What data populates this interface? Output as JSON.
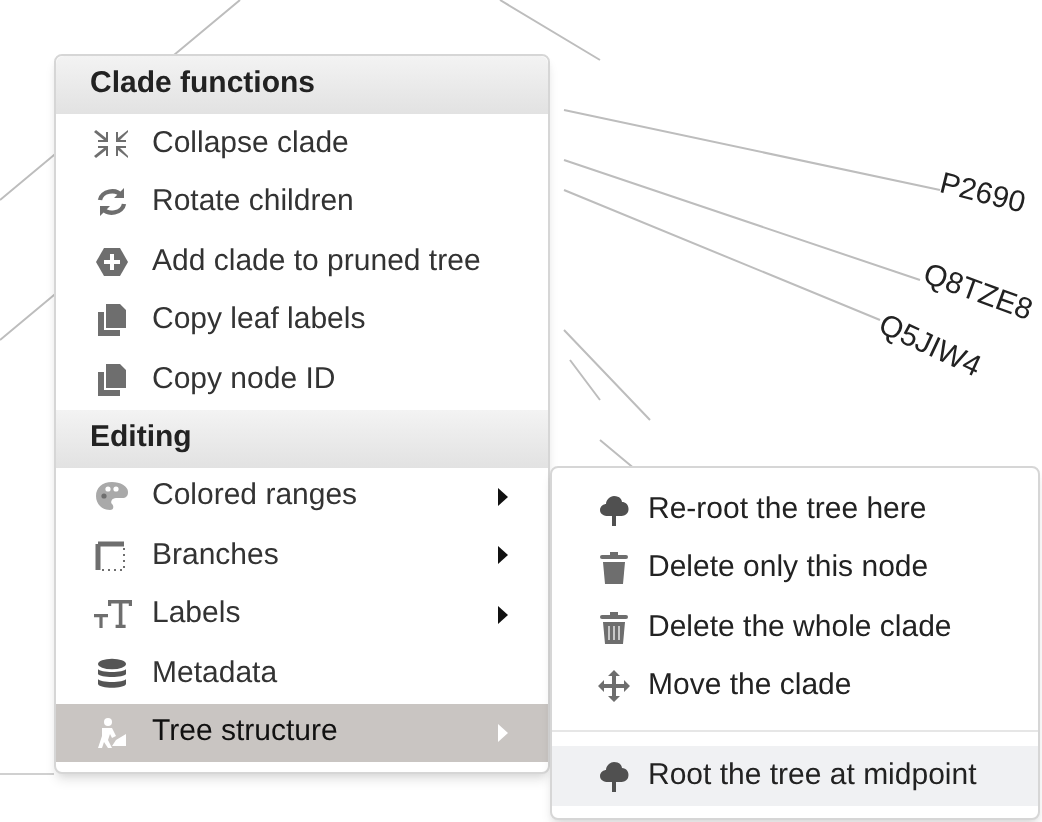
{
  "tree_labels": [
    "P2690",
    "Q8TZE8",
    "Q5JIW4"
  ],
  "context_menu": {
    "sections": [
      {
        "title": "Clade functions",
        "items": [
          {
            "label": "Collapse clade",
            "submenu": false,
            "selected": false
          },
          {
            "label": "Rotate children",
            "submenu": false,
            "selected": false
          },
          {
            "label": "Add clade to pruned tree",
            "submenu": false,
            "selected": false
          },
          {
            "label": "Copy leaf labels",
            "submenu": false,
            "selected": false
          },
          {
            "label": "Copy node ID",
            "submenu": false,
            "selected": false
          }
        ]
      },
      {
        "title": "Editing",
        "items": [
          {
            "label": "Colored ranges",
            "submenu": true,
            "selected": false
          },
          {
            "label": "Branches",
            "submenu": true,
            "selected": false
          },
          {
            "label": "Labels",
            "submenu": true,
            "selected": false
          },
          {
            "label": "Metadata",
            "submenu": false,
            "selected": false
          },
          {
            "label": "Tree structure",
            "submenu": true,
            "selected": true
          }
        ]
      }
    ]
  },
  "submenu": {
    "groups": [
      [
        {
          "label": "Re-root the tree here",
          "selected": false
        },
        {
          "label": "Delete only this node",
          "selected": false
        },
        {
          "label": "Delete the whole clade",
          "selected": false
        },
        {
          "label": "Move the clade",
          "selected": false
        }
      ],
      [
        {
          "label": "Root the tree at midpoint",
          "selected": true
        }
      ]
    ]
  }
}
